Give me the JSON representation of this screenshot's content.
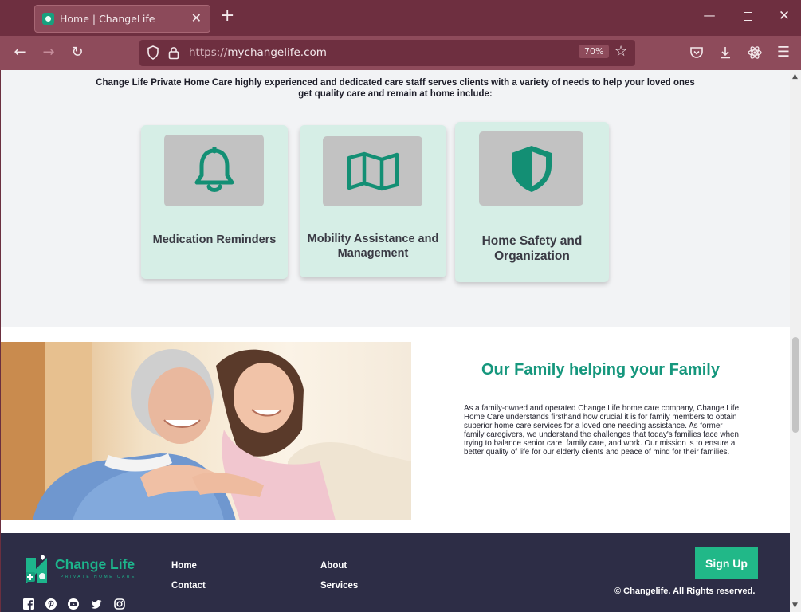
{
  "browser": {
    "tab_title": "Home | ChangeLife",
    "url_scheme": "https://",
    "url_host": "mychangelife.com",
    "zoom": "70%"
  },
  "services": {
    "intro": "Change Life Private Home Care highly experienced and dedicated care staff serves clients with a variety of needs to help your loved ones get quality care and remain at home include:",
    "cards": [
      {
        "label": "Medication Reminders",
        "icon": "bell-icon"
      },
      {
        "label": "Mobility Assistance and Management",
        "icon": "map-icon"
      },
      {
        "label": "Home Safety and Organization",
        "icon": "shield-icon"
      }
    ]
  },
  "family": {
    "heading": "Our Family helping your Family",
    "body": "As a family-owned and operated Change Life home care company, Change Life Home Care understands firsthand how crucial it is for family members to obtain superior home care services for a loved one needing assistance. As former family caregivers, we understand the challenges that today's families face when trying to balance senior care, family care, and work. Our mission is to ensure a better quality of life for our elderly clients and peace of mind for their families."
  },
  "footer": {
    "logo_text": "Change Life",
    "logo_sub": "PRIVATE HOME CARE",
    "links": [
      "Home",
      "Contact",
      "About",
      "Services"
    ],
    "signup": "Sign Up",
    "copyright": "© Changelife. All Rights reserved.",
    "social": [
      "facebook-icon",
      "pinterest-icon",
      "youtube-icon",
      "twitter-icon",
      "instagram-icon"
    ]
  },
  "colors": {
    "accent": "#16977d",
    "card_bg": "#d6eee6",
    "footer_bg": "#2d2d46",
    "chrome_bg": "#8e4b5b"
  }
}
